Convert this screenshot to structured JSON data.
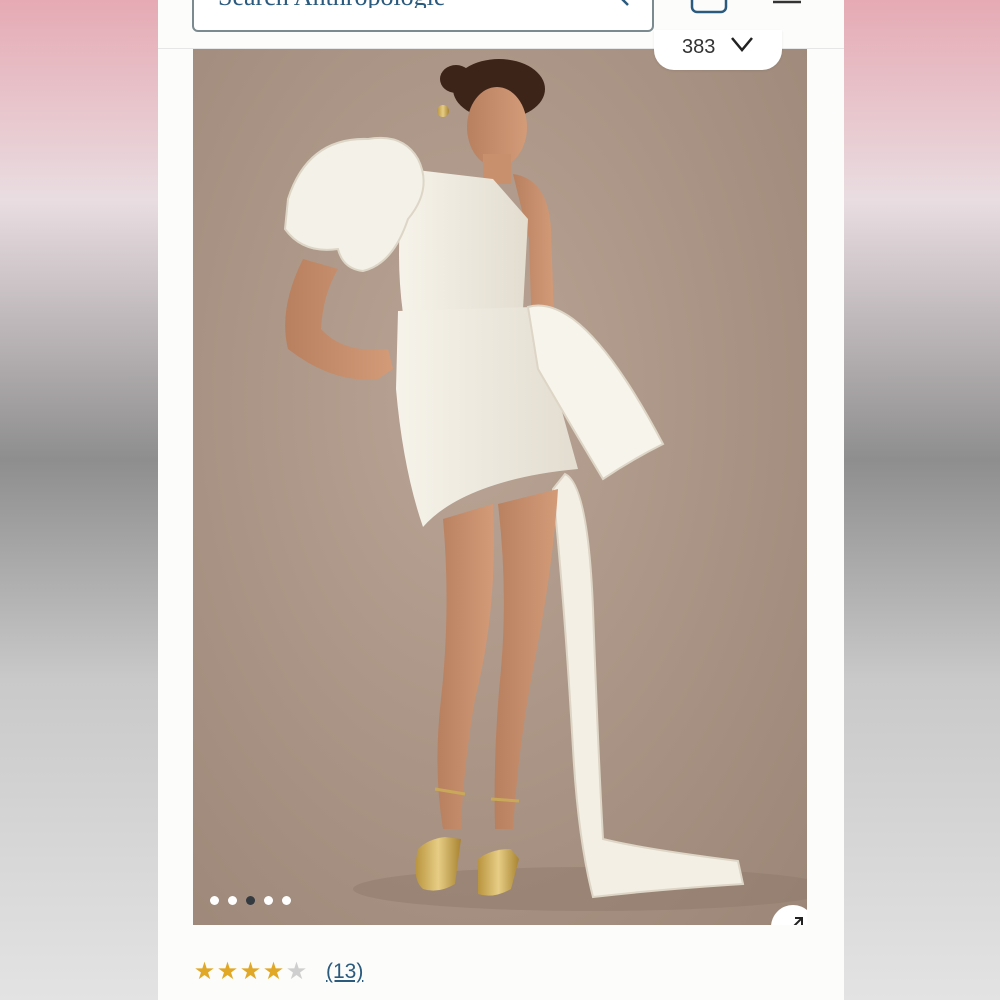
{
  "search": {
    "placeholder": "Search Anthropologie"
  },
  "gallery": {
    "counter": "383",
    "slides_total": 5,
    "active_slide": 3
  },
  "rating": {
    "value": 4,
    "max": 5,
    "review_count_label": "(13)"
  },
  "colors": {
    "link": "#2a5a7e",
    "star": "#e0a826",
    "backdrop": "#a99384"
  },
  "icons": {
    "search": "search-icon",
    "bag": "shopping-bag-icon",
    "menu": "hamburger-menu-icon",
    "counter_chevron": "heart-icon",
    "expand": "expand-icon"
  }
}
